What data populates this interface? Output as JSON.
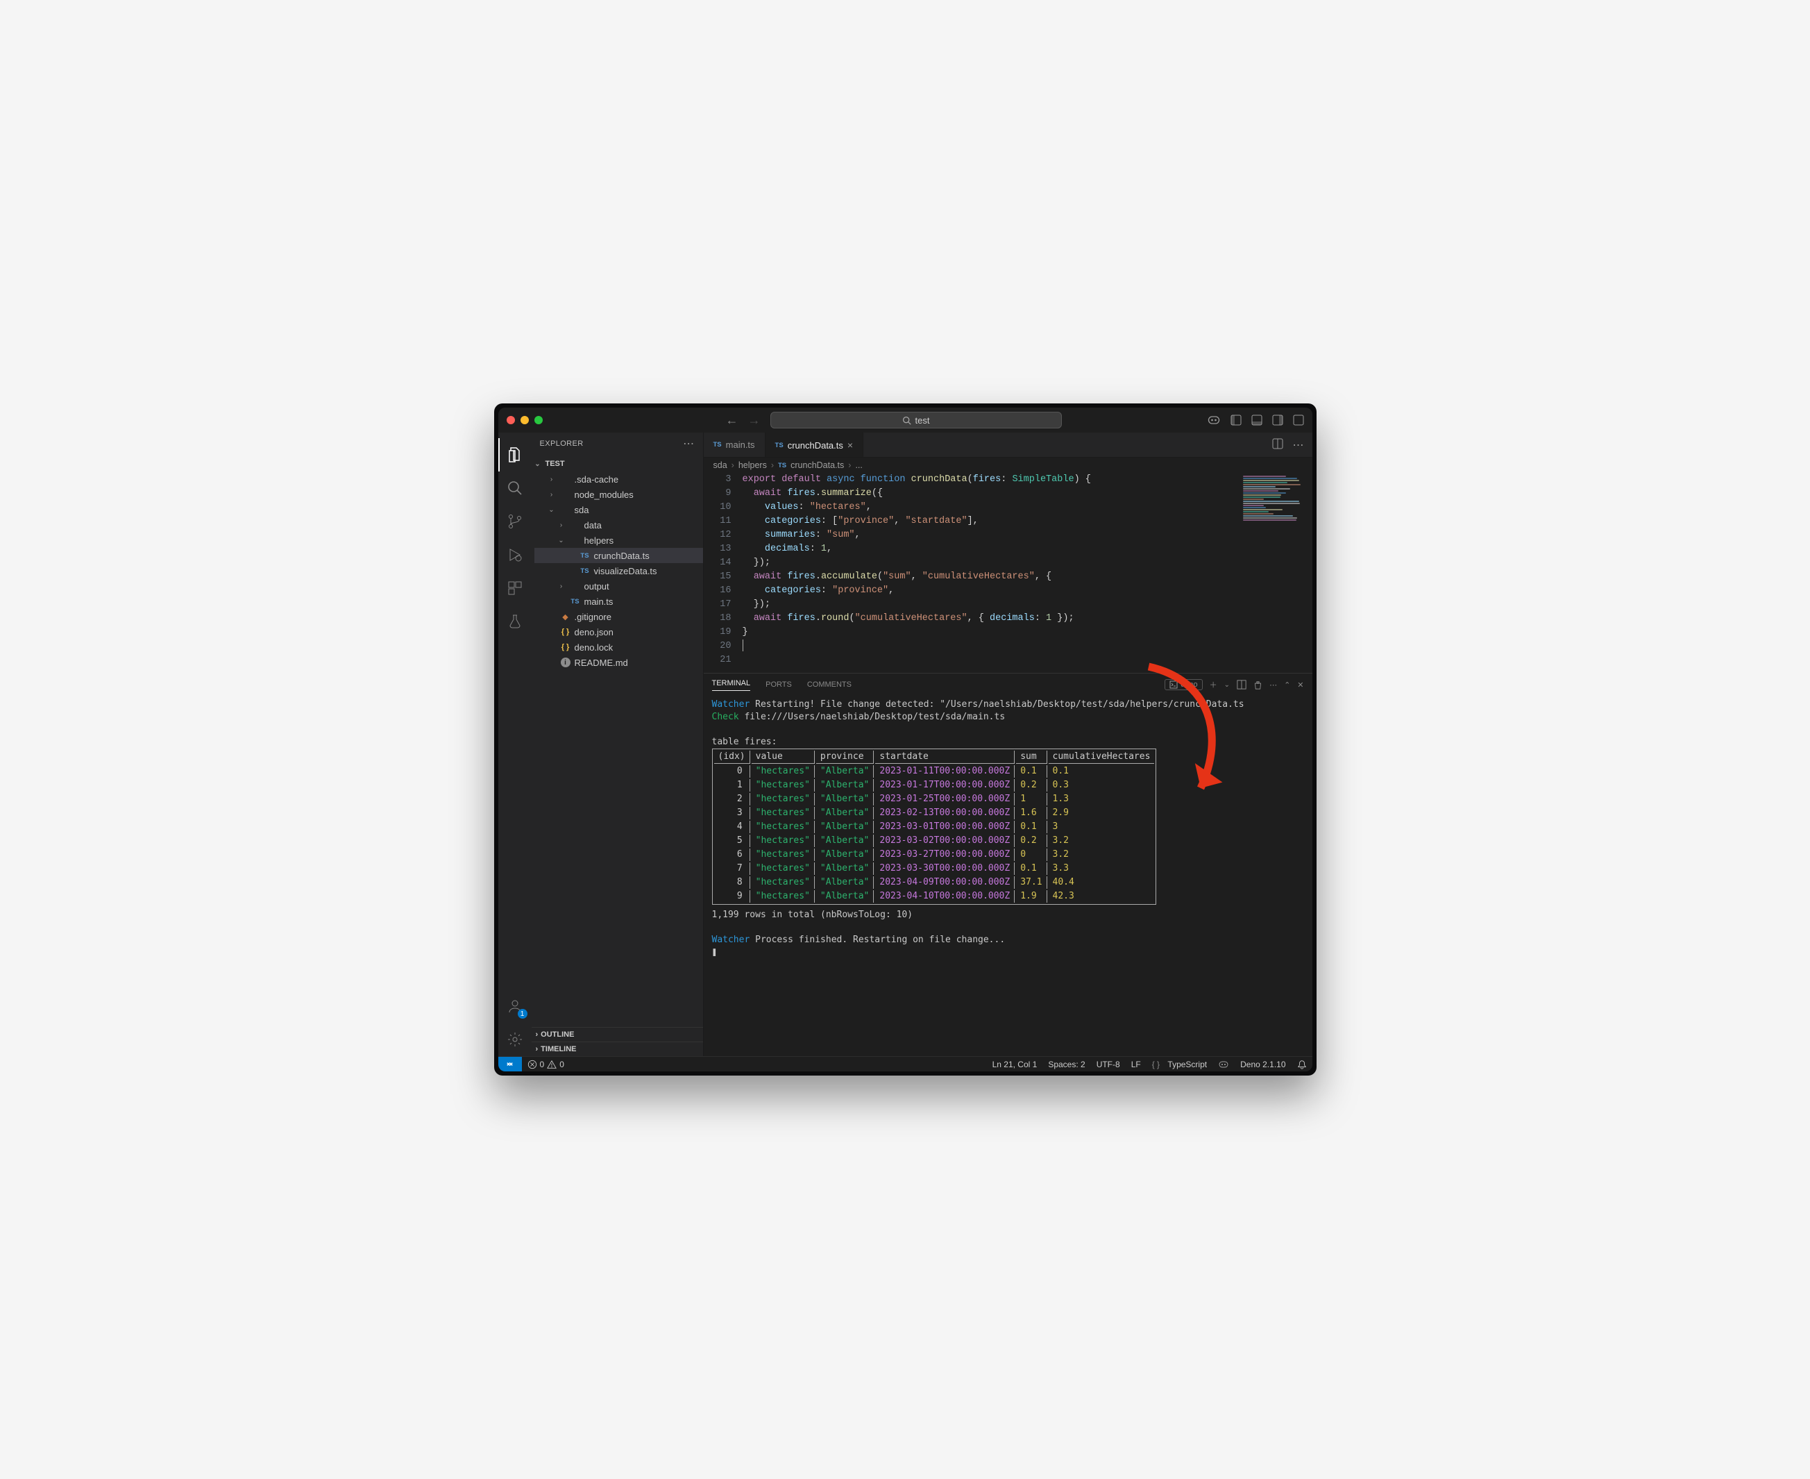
{
  "titlebar": {
    "search_text": "test"
  },
  "activity_badge": "1",
  "sidebar": {
    "header": "EXPLORER",
    "root": "TEST",
    "nodes": [
      {
        "type": "folder",
        "name": ".sda-cache",
        "depth": 1,
        "open": false
      },
      {
        "type": "folder",
        "name": "node_modules",
        "depth": 1,
        "open": false
      },
      {
        "type": "folder",
        "name": "sda",
        "depth": 1,
        "open": true
      },
      {
        "type": "folder",
        "name": "data",
        "depth": 2,
        "open": false
      },
      {
        "type": "folder",
        "name": "helpers",
        "depth": 2,
        "open": true
      },
      {
        "type": "file",
        "name": "crunchData.ts",
        "depth": 3,
        "icon": "ts",
        "selected": true
      },
      {
        "type": "file",
        "name": "visualizeData.ts",
        "depth": 3,
        "icon": "ts"
      },
      {
        "type": "folder",
        "name": "output",
        "depth": 2,
        "open": false
      },
      {
        "type": "file",
        "name": "main.ts",
        "depth": 2,
        "icon": "ts"
      },
      {
        "type": "file",
        "name": ".gitignore",
        "depth": 1,
        "icon": "git"
      },
      {
        "type": "file",
        "name": "deno.json",
        "depth": 1,
        "icon": "json"
      },
      {
        "type": "file",
        "name": "deno.lock",
        "depth": 1,
        "icon": "json"
      },
      {
        "type": "file",
        "name": "README.md",
        "depth": 1,
        "icon": "info"
      }
    ],
    "outline": "OUTLINE",
    "timeline": "TIMELINE"
  },
  "tabs": [
    {
      "label": "main.ts",
      "icon": "ts",
      "active": false,
      "close": false
    },
    {
      "label": "crunchData.ts",
      "icon": "ts",
      "active": true,
      "close": true
    }
  ],
  "breadcrumbs": {
    "parts": [
      "sda",
      "helpers"
    ],
    "file": "crunchData.ts",
    "tail": "..."
  },
  "editor": {
    "line_numbers": [
      3,
      9,
      10,
      11,
      12,
      13,
      14,
      15,
      16,
      17,
      18,
      19,
      20,
      21
    ],
    "lines_html": [
      "<span class='kw'>export</span> <span class='kw'>default</span> <span class='kw2'>async</span> <span class='kw2'>function</span> <span class='fn'>crunchData</span>(<span class='id'>fires</span>: <span class='cls'>SimpleTable</span>) {",
      "",
      "  <span class='kw'>await</span> <span class='id'>fires</span>.<span class='fn'>summarize</span>({",
      "    <span class='id'>values</span>: <span class='str'>\"hectares\"</span>,",
      "    <span class='id'>categories</span>: [<span class='str'>\"province\"</span>, <span class='str'>\"startdate\"</span>],",
      "    <span class='id'>summaries</span>: <span class='str'>\"sum\"</span>,",
      "    <span class='id'>decimals</span>: <span class='num'>1</span>,",
      "  });",
      "  <span class='kw'>await</span> <span class='id'>fires</span>.<span class='fn'>accumulate</span>(<span class='str'>\"sum\"</span>, <span class='str'>\"cumulativeHectares\"</span>, {",
      "    <span class='id'>categories</span>: <span class='str'>\"province\"</span>,",
      "  });",
      "  <span class='kw'>await</span> <span class='id'>fires</span>.<span class='fn'>round</span>(<span class='str'>\"cumulativeHectares\"</span>, { <span class='id'>decimals</span>: <span class='num'>1</span> });",
      "}",
      "<span class='cursor'></span>"
    ]
  },
  "panel": {
    "tabs": {
      "terminal": "TERMINAL",
      "ports": "PORTS",
      "comments": "COMMENTS"
    },
    "deno_tag": "deno",
    "line1_a": "Watcher",
    "line1_b": " Restarting! File change detected: \"/Users/naelshiab/Desktop/test/sda/helpers/crunchData.ts",
    "line2_a": "Check",
    "line2_b": " file:///Users/naelshiab/Desktop/test/sda/main.ts",
    "tabletitle": "table fires:",
    "headers": [
      "(idx)",
      "value",
      "province",
      "startdate",
      "sum",
      "cumulativeHectares"
    ],
    "rows": [
      {
        "idx": "0",
        "value": "\"hectares\"",
        "province": "\"Alberta\"",
        "startdate": "2023-01-11T00:00:00.000Z",
        "sum": "0.1",
        "cum": "0.1"
      },
      {
        "idx": "1",
        "value": "\"hectares\"",
        "province": "\"Alberta\"",
        "startdate": "2023-01-17T00:00:00.000Z",
        "sum": "0.2",
        "cum": "0.3"
      },
      {
        "idx": "2",
        "value": "\"hectares\"",
        "province": "\"Alberta\"",
        "startdate": "2023-01-25T00:00:00.000Z",
        "sum": "1",
        "cum": "1.3"
      },
      {
        "idx": "3",
        "value": "\"hectares\"",
        "province": "\"Alberta\"",
        "startdate": "2023-02-13T00:00:00.000Z",
        "sum": "1.6",
        "cum": "2.9"
      },
      {
        "idx": "4",
        "value": "\"hectares\"",
        "province": "\"Alberta\"",
        "startdate": "2023-03-01T00:00:00.000Z",
        "sum": "0.1",
        "cum": "3"
      },
      {
        "idx": "5",
        "value": "\"hectares\"",
        "province": "\"Alberta\"",
        "startdate": "2023-03-02T00:00:00.000Z",
        "sum": "0.2",
        "cum": "3.2"
      },
      {
        "idx": "6",
        "value": "\"hectares\"",
        "province": "\"Alberta\"",
        "startdate": "2023-03-27T00:00:00.000Z",
        "sum": "0",
        "cum": "3.2"
      },
      {
        "idx": "7",
        "value": "\"hectares\"",
        "province": "\"Alberta\"",
        "startdate": "2023-03-30T00:00:00.000Z",
        "sum": "0.1",
        "cum": "3.3"
      },
      {
        "idx": "8",
        "value": "\"hectares\"",
        "province": "\"Alberta\"",
        "startdate": "2023-04-09T00:00:00.000Z",
        "sum": "37.1",
        "cum": "40.4"
      },
      {
        "idx": "9",
        "value": "\"hectares\"",
        "province": "\"Alberta\"",
        "startdate": "2023-04-10T00:00:00.000Z",
        "sum": "1.9",
        "cum": "42.3"
      }
    ],
    "rowstotal": "1,199 rows in total (nbRowsToLog: 10)",
    "line3_a": "Watcher",
    "line3_b": " Process finished. Restarting on file change...",
    "promptchar": "❚"
  },
  "status": {
    "errors": "0",
    "warnings": "0",
    "lncol": "Ln 21, Col 1",
    "spaces": "Spaces: 2",
    "encoding": "UTF-8",
    "eol": "LF",
    "lang": "TypeScript",
    "deno": "Deno 2.1.10"
  }
}
